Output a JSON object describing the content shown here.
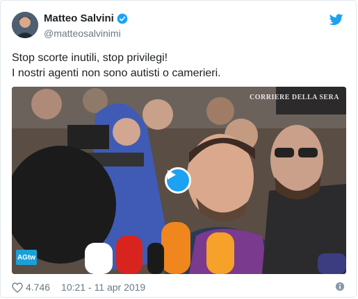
{
  "author": {
    "name": "Matteo Salvini",
    "handle": "@matteosalvinimi",
    "verified": true,
    "avatar_icon": "avatar"
  },
  "tweet": {
    "lines": [
      "Stop scorte inutili, stop privilegi!",
      "I nostri agenti non sono autisti o camerieri."
    ]
  },
  "media": {
    "type": "video",
    "watermark_top": "CORRIERE DELLA SERA",
    "watermark_logo": "AGtw",
    "play_icon": "play-icon"
  },
  "footer": {
    "likes": "4.746",
    "timestamp": "10:21 - 11 apr 2019"
  },
  "colors": {
    "twitter_blue": "#1da1f2",
    "text": "#1c2022",
    "muted": "#697882",
    "border": "#e1e8ed"
  }
}
